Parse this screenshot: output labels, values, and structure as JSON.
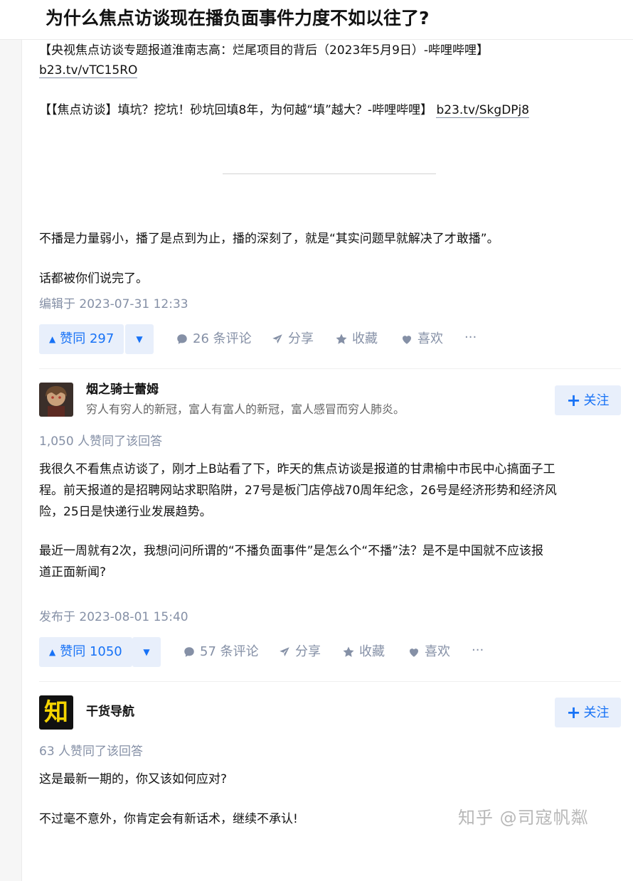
{
  "question": {
    "title": "为什么焦点访谈现在播负面事件力度不如以往了?"
  },
  "answer1": {
    "line1": "【央视焦点访谈专题报道淮南志高：烂尾项目的背后（2023年5月9日）-哔哩哔哩】",
    "link1": "b23.tv/vTC15RO",
    "line2": "【【焦点访谈】填坑？挖坑！砂坑回填8年，为何越“填”越大？-哔哩哔哩】",
    "link2": "b23.tv/SkgDPj8",
    "para1": "不播是力量弱小，播了是点到为止，播的深刻了，就是“其实问题早就解决了才敢播”。",
    "para2": "话都被你们说完了。",
    "edited": "编辑于 2023-07-31 12:33",
    "vote_label": "赞同 297",
    "comments": "26 条评论",
    "share": "分享",
    "collect": "收藏",
    "like": "喜欢",
    "more": "···"
  },
  "answer2": {
    "author": "烟之骑士蕾姆",
    "bio": "穷人有穷人的新冠，富人有富人的新冠，富人感冒而穷人肺炎。",
    "follow": "关注",
    "upvoted": "1,050 人赞同了该回答",
    "para1a": "我很久不看焦点访谈了，刚才上B站看了下，昨天的焦点访谈是报道的甘肃榆中市民中心搞面子工",
    "para1b": "程。前天报道的是招聘网站求职陷阱，27号是板门店停战70周年纪念，26号是经济形势和经济风",
    "para1c": "险，25日是快递行业发展趋势。",
    "para2a": "最近一周就有2次，我想问问所谓的“不播负面事件”是怎么个“不播”法？是不是中国就不应该报",
    "para2b": "道正面新闻?",
    "published": "发布于 2023-08-01 15:40",
    "vote_label": "赞同 1050",
    "comments": "57 条评论",
    "share": "分享",
    "collect": "收藏",
    "like": "喜欢",
    "more": "···"
  },
  "answer3": {
    "author": "干货导航",
    "avatar_char": "知",
    "follow": "关注",
    "upvoted": "63 人赞同了该回答",
    "para1": "这是最新一期的，你又该如何应对?",
    "para2": "不过毫不意外，你肯定会有新话术，继续不承认!"
  },
  "watermark": "知乎 @司寇帆粼",
  "colors": {
    "accent": "#1772f6",
    "accent_bg": "#e8effb",
    "meta": "#8590a6"
  }
}
